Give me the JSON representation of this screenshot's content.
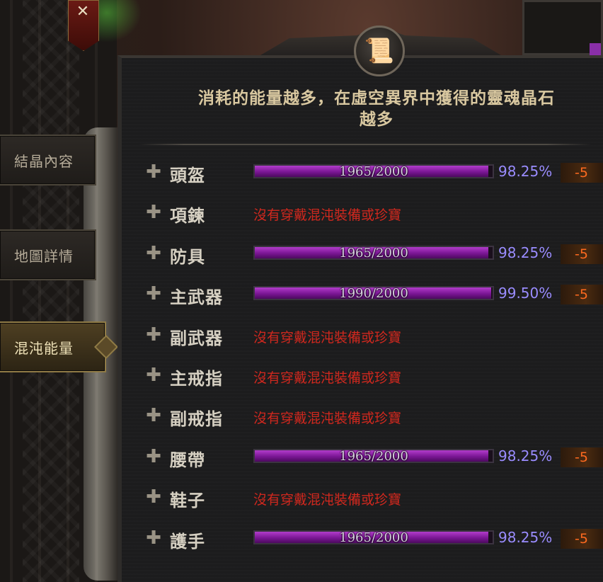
{
  "side_tabs": [
    {
      "label": "結晶內容",
      "active": false
    },
    {
      "label": "地圖詳情",
      "active": false
    },
    {
      "label": "混沌能量",
      "active": true
    }
  ],
  "headline": {
    "line1": "消耗的能量越多，在虛空異界中獲得的靈魂晶石",
    "line2": "越多"
  },
  "icons": {
    "banner": "crossed-swords-icon",
    "emblem": "scroll-icon",
    "row_expand": "plus-icon"
  },
  "colors": {
    "bar_fill": "#9a2bb5",
    "percent": "#9a8cff",
    "delta": "#ff6a1f",
    "empty_message": "#d0281e"
  },
  "slots": [
    {
      "name": "頭盔",
      "equipped": true,
      "current": 1965,
      "max": 2000,
      "bar_text": "1965/2000",
      "percent": "98.25%",
      "delta": "-5"
    },
    {
      "name": "項鍊",
      "equipped": false,
      "message": "沒有穿戴混沌裝備或珍寶"
    },
    {
      "name": "防具",
      "equipped": true,
      "current": 1965,
      "max": 2000,
      "bar_text": "1965/2000",
      "percent": "98.25%",
      "delta": "-5"
    },
    {
      "name": "主武器",
      "equipped": true,
      "current": 1990,
      "max": 2000,
      "bar_text": "1990/2000",
      "percent": "99.50%",
      "delta": "-5"
    },
    {
      "name": "副武器",
      "equipped": false,
      "message": "沒有穿戴混沌裝備或珍寶"
    },
    {
      "name": "主戒指",
      "equipped": false,
      "message": "沒有穿戴混沌裝備或珍寶"
    },
    {
      "name": "副戒指",
      "equipped": false,
      "message": "沒有穿戴混沌裝備或珍寶"
    },
    {
      "name": "腰帶",
      "equipped": true,
      "current": 1965,
      "max": 2000,
      "bar_text": "1965/2000",
      "percent": "98.25%",
      "delta": "-5"
    },
    {
      "name": "鞋子",
      "equipped": false,
      "message": "沒有穿戴混沌裝備或珍寶"
    },
    {
      "name": "護手",
      "equipped": true,
      "current": 1965,
      "max": 2000,
      "bar_text": "1965/2000",
      "percent": "98.25%",
      "delta": "-5"
    }
  ]
}
